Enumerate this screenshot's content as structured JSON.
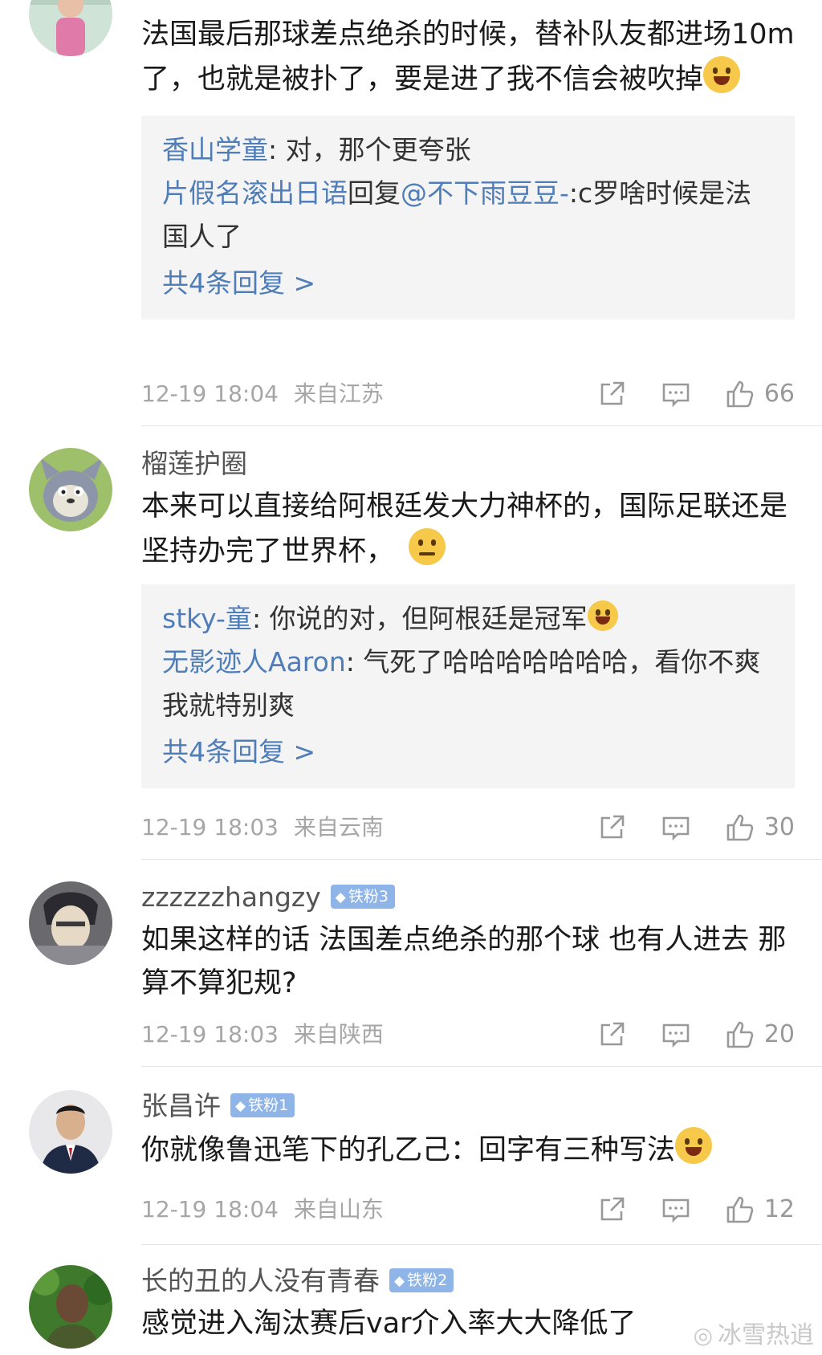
{
  "comments": [
    {
      "text": "法国最后那球差点绝杀的时候，替补队友都进场10m了，也就是被扑了，要是进了我不信会被吹掉",
      "replies": [
        {
          "name": "香山学童",
          "text": ": 对，那个更夸张"
        },
        {
          "name": "片假名滚出日语",
          "mid": "回复",
          "at": "@不下雨豆豆-",
          "text": ":c罗啥时候是法国人了"
        }
      ],
      "more": "共4条回复 >",
      "time": "12-19 18:04",
      "location": "来自江苏",
      "likes": "66"
    },
    {
      "username": "榴莲护圈",
      "text": "本来可以直接给阿根廷发大力神杯的，国际足联还是坚持办完了世界杯，",
      "replies": [
        {
          "name": "stky-童",
          "text": ": 你说的对，但阿根廷是冠军"
        },
        {
          "name": "无影迹人Aaron",
          "text": ": 气死了哈哈哈哈哈哈哈，看你不爽我就特别爽"
        }
      ],
      "more": "共4条回复 >",
      "time": "12-19 18:03",
      "location": "来自云南",
      "likes": "30"
    },
    {
      "username": "zzzzzzhangzy",
      "badge": "铁粉3",
      "text": "如果这样的话 法国差点绝杀的那个球 也有人进去 那算不算犯规?",
      "time": "12-19 18:03",
      "location": "来自陕西",
      "likes": "20"
    },
    {
      "username": "张昌许",
      "badge": "铁粉1",
      "text": "你就像鲁迅笔下的孔乙己：回字有三种写法",
      "time": "12-19 18:04",
      "location": "来自山东",
      "likes": "12"
    },
    {
      "username": "长的丑的人没有青春",
      "badge": "铁粉2",
      "text": "感觉进入淘汰赛后var介入率大大降低了"
    }
  ],
  "watermark": "冰雪热逍",
  "colors": {
    "link": "#4f7db8",
    "badge": "#8fb4e8",
    "reply_bg": "#f4f4f4"
  }
}
